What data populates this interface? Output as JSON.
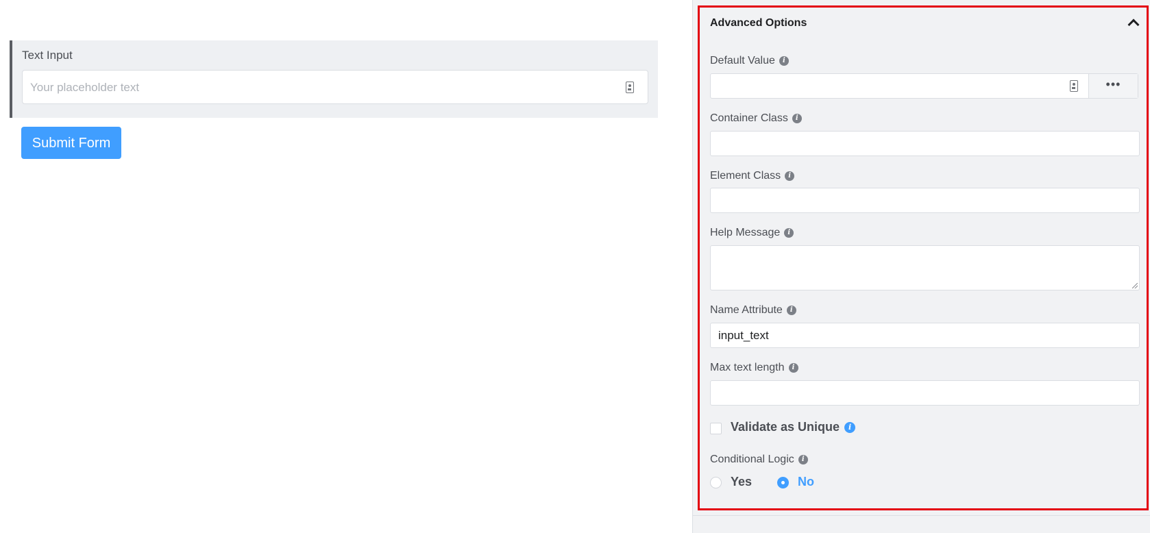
{
  "preview": {
    "field_label": "Text Input",
    "input_placeholder": "Your placeholder text",
    "submit_label": "Submit Form"
  },
  "panel": {
    "section_title": "Advanced Options",
    "default_value": {
      "label": "Default Value",
      "value": "",
      "addon": "•••"
    },
    "container_class": {
      "label": "Container Class",
      "value": ""
    },
    "element_class": {
      "label": "Element Class",
      "value": ""
    },
    "help_message": {
      "label": "Help Message",
      "value": ""
    },
    "name_attribute": {
      "label": "Name Attribute",
      "value": "input_text"
    },
    "max_text_length": {
      "label": "Max text length",
      "value": ""
    },
    "validate_unique": {
      "label": "Validate as Unique",
      "checked": false
    },
    "conditional_logic": {
      "label": "Conditional Logic",
      "options": [
        "Yes",
        "No"
      ],
      "selected": "No"
    }
  },
  "colors": {
    "accent": "#409eff",
    "highlight_border": "#e3000f",
    "panel_bg": "#f1f2f4",
    "preview_bg": "#eef0f3"
  },
  "icons": [
    "contact-card-icon",
    "info-icon",
    "chevron-up-icon",
    "more-icon"
  ]
}
